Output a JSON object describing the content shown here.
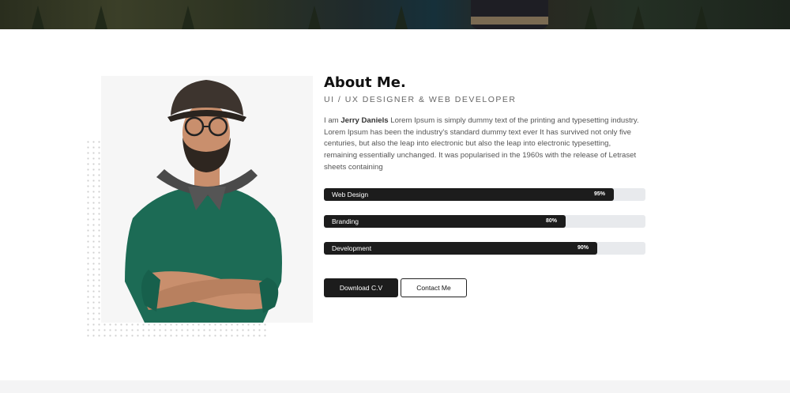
{
  "about": {
    "title": "About Me.",
    "subtitle": "UI / UX DESIGNER & WEB DEVELOPER",
    "bio_prefix": "I am ",
    "bio_name": "Jerry Daniels",
    "bio_text": " Lorem Ipsum is simply dummy text of the printing and typesetting industry. Lorem Ipsum has been the industry's standard dummy text ever It has survived not only five centuries, but also the leap into electronic but also the leap into electronic typesetting, remaining essentially unchanged. It was popularised in the 1960s with the release of Letraset sheets containing"
  },
  "skills": [
    {
      "label": "Web Design",
      "percent_text": "95%",
      "level": 0.95
    },
    {
      "label": "Branding",
      "percent_text": "80%",
      "level": 0.8
    },
    {
      "label": "Development",
      "percent_text": "90%",
      "level": 0.9
    }
  ],
  "buttons": {
    "download": "Download C.V",
    "contact": "Contact Me"
  },
  "colors": {
    "accent": "#1c1c1c",
    "track": "#e8eaed",
    "sweater": "#1c6b55"
  }
}
